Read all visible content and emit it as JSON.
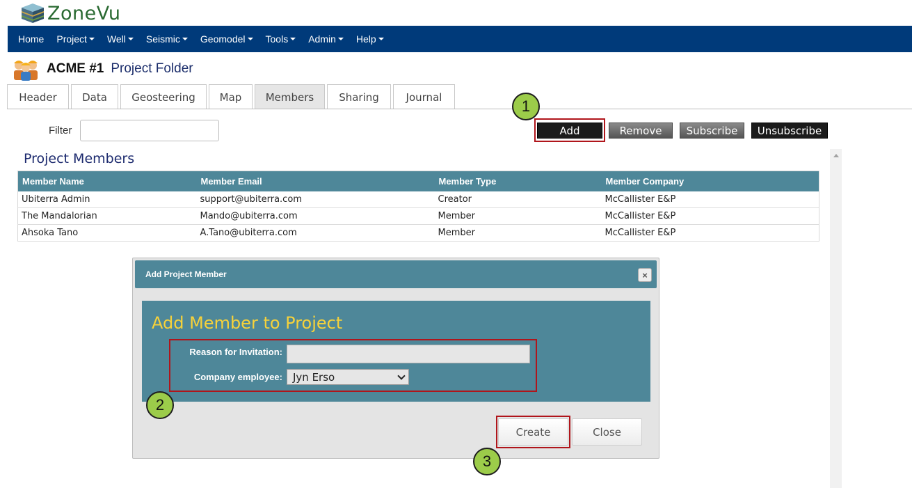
{
  "app": {
    "name": "ZoneVu"
  },
  "nav": {
    "items": [
      {
        "label": "Home",
        "dropdown": false
      },
      {
        "label": "Project",
        "dropdown": true
      },
      {
        "label": "Well",
        "dropdown": true
      },
      {
        "label": "Seismic",
        "dropdown": true
      },
      {
        "label": "Geomodel",
        "dropdown": true
      },
      {
        "label": "Tools",
        "dropdown": true
      },
      {
        "label": "Admin",
        "dropdown": true
      },
      {
        "label": "Help",
        "dropdown": true
      }
    ]
  },
  "page": {
    "project_name": "ACME #1",
    "subtitle": "Project Folder"
  },
  "tabs": [
    {
      "label": "Header",
      "active": false
    },
    {
      "label": "Data",
      "active": false
    },
    {
      "label": "Geosteering",
      "active": false
    },
    {
      "label": "Map",
      "active": false
    },
    {
      "label": "Members",
      "active": true
    },
    {
      "label": "Sharing",
      "active": false
    },
    {
      "label": "Journal",
      "active": false
    }
  ],
  "filter": {
    "label": "Filter",
    "value": ""
  },
  "actions": {
    "add": "Add",
    "remove": "Remove",
    "subscribe": "Subscribe",
    "unsubscribe": "Unsubscribe"
  },
  "markers": {
    "one": "1",
    "two": "2",
    "three": "3"
  },
  "members": {
    "title": "Project Members",
    "columns": [
      "Member Name",
      "Member Email",
      "Member Type",
      "Member Company"
    ],
    "rows": [
      [
        "Ubiterra Admin",
        "support@ubiterra.com",
        "Creator",
        "McCallister E&P"
      ],
      [
        "The Mandalorian",
        "Mando@ubiterra.com",
        "Member",
        "McCallister E&P"
      ],
      [
        "Ahsoka Tano",
        "A.Tano@ubiterra.com",
        "Member",
        "McCallister E&P"
      ]
    ]
  },
  "dialog": {
    "title": "Add Project Member",
    "heading": "Add Member to Project",
    "reason_label": "Reason for Invitation:",
    "reason_value": "",
    "employee_label": "Company employee:",
    "employee_value": "Jyn Erso",
    "create_label": "Create",
    "close_label": "Close",
    "close_icon": "×"
  },
  "colors": {
    "nav_bg": "#003a7a",
    "table_header": "#4e8799",
    "dialog_heading": "#f7d23a",
    "marker_green": "#9ccc4a",
    "highlight_red": "#b0151b"
  }
}
